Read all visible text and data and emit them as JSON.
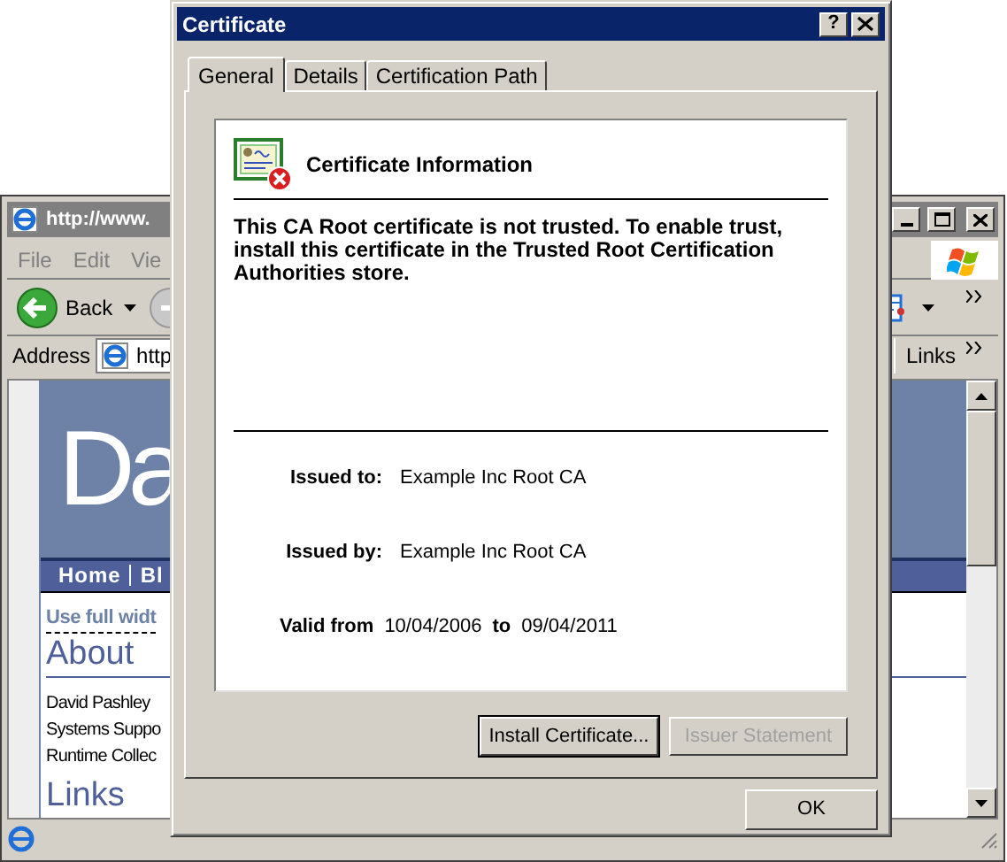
{
  "browser": {
    "title": "http://www.",
    "menu": [
      "File",
      "Edit",
      "Vie"
    ],
    "back": "Back",
    "address": {
      "label": "Address",
      "value": "http"
    },
    "links": "Links",
    "page": {
      "logo": "Da",
      "nav": [
        "Home",
        "Bl"
      ],
      "link": "Use full widt",
      "heading": "About",
      "lines": [
        "David Pashley",
        "Systems Suppo",
        "Runtime Collec"
      ],
      "heading2": "Links"
    }
  },
  "dialog": {
    "title": "Certificate",
    "help": "?",
    "tabs": [
      {
        "label": "General",
        "selected": true
      },
      {
        "label": "Details",
        "selected": false
      },
      {
        "label": "Certification Path",
        "selected": false
      }
    ],
    "header": "Certificate Information",
    "message": "This CA Root certificate is not trusted. To enable trust, install this certificate in the Trusted Root Certification Authorities store.",
    "fields": [
      {
        "label": "Issued to:",
        "value": "Example Inc Root CA"
      },
      {
        "label": "Issued by:",
        "value": "Example Inc Root CA"
      }
    ],
    "validity": {
      "label": "Valid from",
      "from": "10/04/2006",
      "to_label": "to",
      "to": "09/04/2011"
    },
    "buttons": [
      {
        "label": "Install Certificate...",
        "disabled": false
      },
      {
        "label": "Issuer Statement",
        "disabled": true
      }
    ],
    "ok": "OK"
  }
}
